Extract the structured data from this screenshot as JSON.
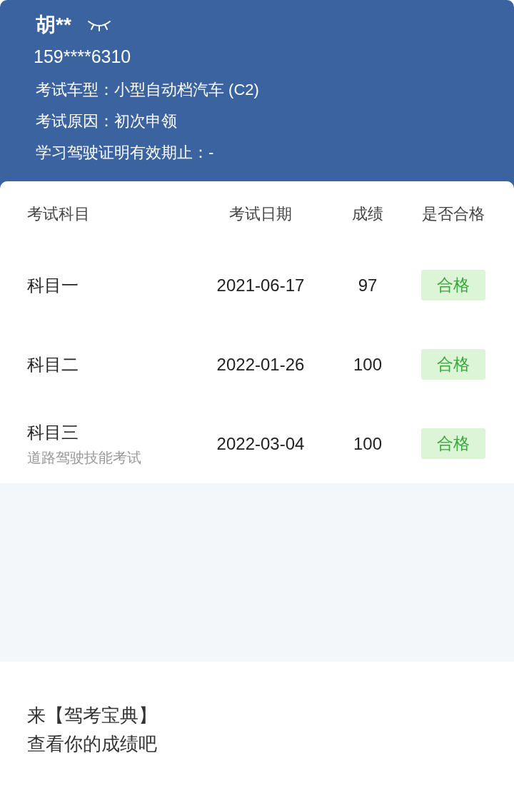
{
  "profile": {
    "name": "胡**",
    "phone": "159****6310",
    "info": [
      {
        "label": "考试车型：",
        "value": "小型自动档汽车 (C2)"
      },
      {
        "label": "考试原因：",
        "value": "初次申领"
      },
      {
        "label": "学习驾驶证明有效期止：",
        "value": "-"
      }
    ]
  },
  "table": {
    "columns": [
      "考试科目",
      "考试日期",
      "成绩",
      "是否合格"
    ],
    "rows": [
      {
        "subject": "科目一",
        "date": "2021-06-17",
        "score": "97",
        "result": "合格",
        "passed": true
      },
      {
        "subject": "科目二",
        "date": "2022-01-26",
        "score": "100",
        "result": "合格",
        "passed": true
      },
      {
        "subject": "科目三",
        "note": "道路驾驶技能考试",
        "date": "2022-03-04",
        "score": "100",
        "result": "合格",
        "passed": true
      }
    ]
  },
  "footer": {
    "lines": [
      "来【驾考宝典】",
      "查看你的成绩吧"
    ]
  }
}
